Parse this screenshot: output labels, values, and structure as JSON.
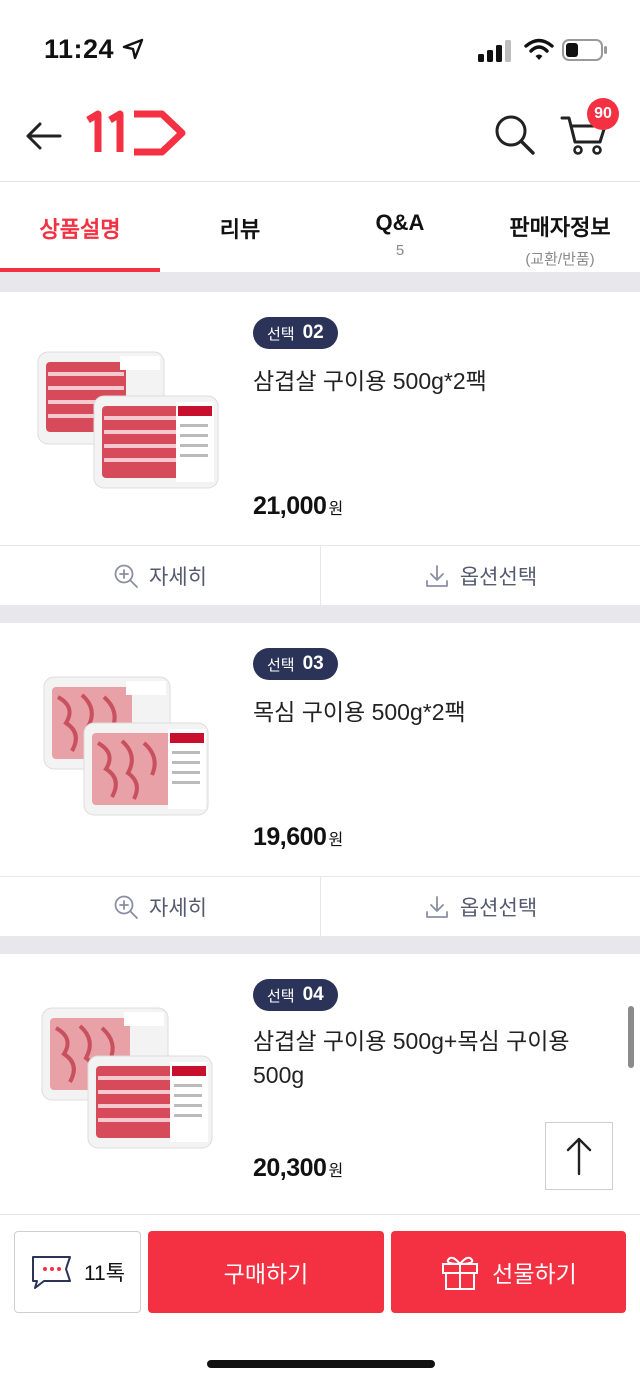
{
  "status": {
    "time": "11:24"
  },
  "header": {
    "cart_count": "90"
  },
  "tabs": [
    {
      "label": "상품설명",
      "sub": ""
    },
    {
      "label": "리뷰",
      "sub": ""
    },
    {
      "label": "Q&A",
      "sub": "5"
    },
    {
      "label": "판매자정보",
      "sub": "(교환/반품)"
    }
  ],
  "products": [
    {
      "badge": "선택",
      "number": "02",
      "name": "삼겹살 구이용 500g*2팩",
      "price": "21,000",
      "unit": "원",
      "detail_label": "자세히",
      "option_label": "옵션선택"
    },
    {
      "badge": "선택",
      "number": "03",
      "name": "목심 구이용 500g*2팩",
      "price": "19,600",
      "unit": "원",
      "detail_label": "자세히",
      "option_label": "옵션선택"
    },
    {
      "badge": "선택",
      "number": "04",
      "name": "삼겹살 구이용 500g+목심 구이용 500g",
      "price": "20,300",
      "unit": "원"
    }
  ],
  "bottom": {
    "talk_label": "11톡",
    "buy_label": "구매하기",
    "gift_label": "선물하기"
  },
  "colors": {
    "accent": "#f43142",
    "badge_bg": "#2b3358"
  }
}
